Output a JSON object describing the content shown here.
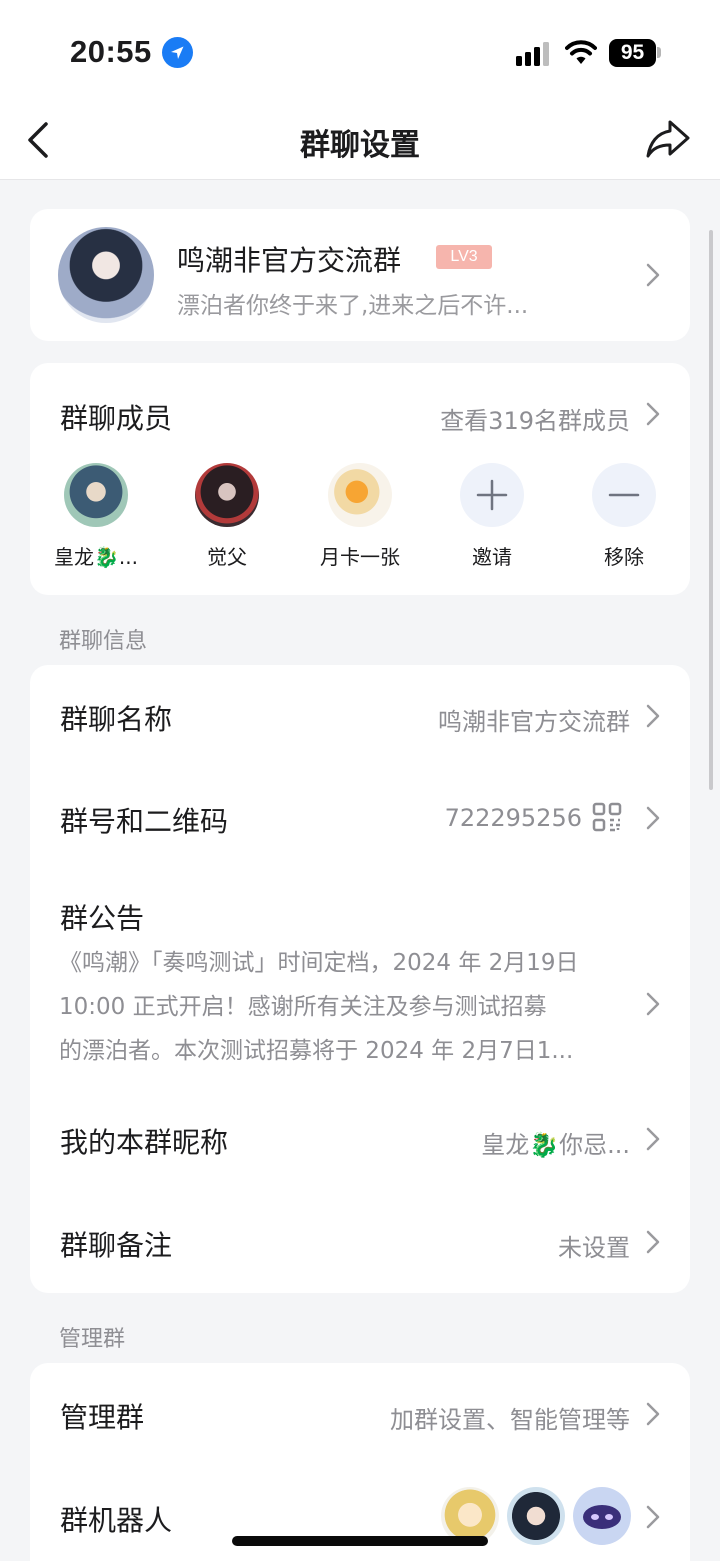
{
  "status_bar": {
    "time": "20:55",
    "battery": "95"
  },
  "nav": {
    "title": "群聊设置"
  },
  "group": {
    "name": "鸣潮非官方交流群",
    "level": "LV3",
    "description": "漂泊者你终于来了,进来之后不许..."
  },
  "members": {
    "title": "群聊成员",
    "view_all": "查看319名群成员",
    "list": [
      {
        "name": "皇龙🐉...",
        "color": "#4a6f8a"
      },
      {
        "name": "觉父",
        "color": "#3a2a2e"
      },
      {
        "name": "月卡一张",
        "color": "#f4d7a6"
      }
    ],
    "invite_label": "邀请",
    "remove_label": "移除"
  },
  "info_section": {
    "label": "群聊信息",
    "group_name_label": "群聊名称",
    "group_name_value": "鸣潮非官方交流群",
    "group_id_label": "群号和二维码",
    "group_id_value": "722295256",
    "notice_label": "群公告",
    "notice_lines": [
      "《鸣潮》「奏鸣测试」时间定档，2024 年 2月19日",
      "10:00 正式开启！感谢所有关注及参与测试招募",
      "的漂泊者。本次测试招募将于 2024 年 2月7日1..."
    ],
    "nickname_label": "我的本群昵称",
    "nickname_value": "皇龙🐉你忌...",
    "remark_label": "群聊备注",
    "remark_value": "未设置"
  },
  "manage_section": {
    "label": "管理群",
    "manage_label": "管理群",
    "manage_value": "加群设置、智能管理等",
    "robot_label": "群机器人"
  },
  "colors": {
    "accent": "#1a7cf5",
    "badge": "#f6b5ad",
    "background": "#f4f5f7"
  }
}
